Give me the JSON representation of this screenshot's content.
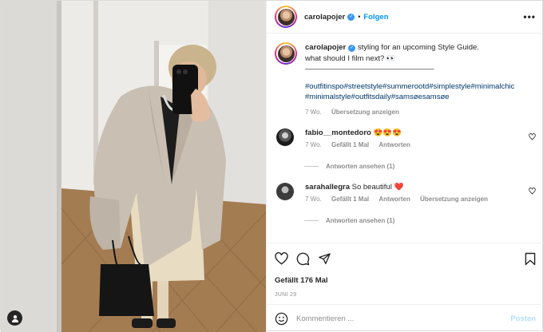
{
  "post": {
    "username": "carolapojer",
    "verified_badge": "✓",
    "dot": "•",
    "follow_label": "Folgen",
    "more_label": "•••"
  },
  "caption": {
    "username": "carolapojer",
    "text_line1": " styling for an upcoming Style Guide.",
    "text_line2": "what should I film next? 👀",
    "divider": "—————————————————",
    "hashtags": "#outfitinspo#streetstyle#summerootd#simplestyle#minimalchic #minimalstyle#outfitsdaily#samsøesamsøe",
    "age": "7 Wo.",
    "translate_label": "Übersetzung anzeigen"
  },
  "comments": [
    {
      "username": "fabio__montedoro",
      "text": " 😍😍😍",
      "age": "7 Wo.",
      "likes": "Gefällt 1 Mal",
      "reply_label": "Antworten",
      "translate_label": "",
      "view_replies": "Antworten ansehen (1)"
    },
    {
      "username": "sarahallegra",
      "text": " So beautiful ❤️",
      "age": "7 Wo.",
      "likes": "Gefällt 1 Mal",
      "reply_label": "Antworten",
      "translate_label": "Übersetzung anzeigen",
      "view_replies": "Antworten ansehen (1)"
    }
  ],
  "actions": {
    "likes_text": "Gefällt 176 Mal",
    "date_text": "JUNI 29"
  },
  "composer": {
    "placeholder": "Kommentieren ...",
    "post_label": "Posten"
  },
  "icons": [
    "user-tag-icon",
    "more-options-icon",
    "heart-icon",
    "comment-icon",
    "share-icon",
    "bookmark-icon",
    "emoji-icon"
  ]
}
